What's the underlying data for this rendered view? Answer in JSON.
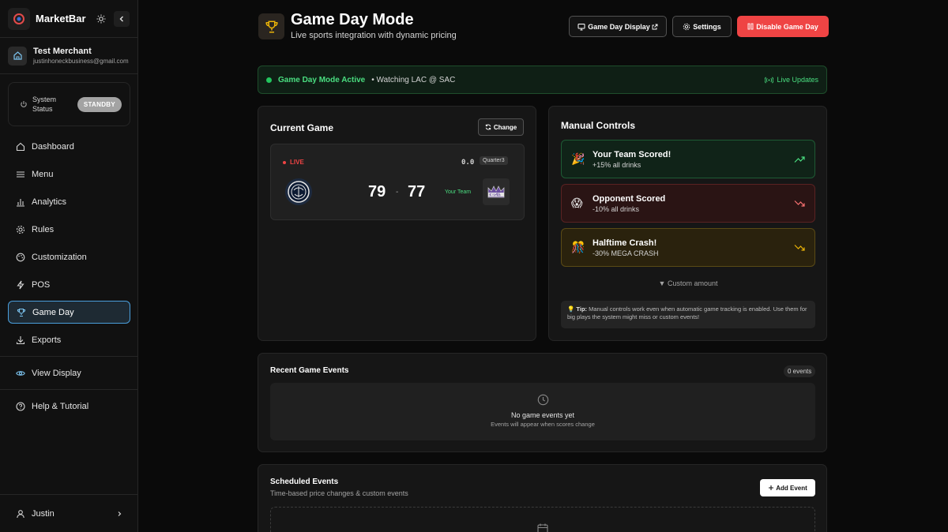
{
  "sidebar": {
    "brand": "MarketBar",
    "merchant": {
      "name": "Test Merchant",
      "email": "justinhoneckbusiness@gmail.com"
    },
    "status": {
      "label": "System Status",
      "value": "STANDBY"
    },
    "items": [
      {
        "label": "Dashboard",
        "icon": "home-icon"
      },
      {
        "label": "Menu",
        "icon": "menu-icon"
      },
      {
        "label": "Analytics",
        "icon": "bar-chart-icon"
      },
      {
        "label": "Rules",
        "icon": "gear-icon"
      },
      {
        "label": "Customization",
        "icon": "palette-icon"
      },
      {
        "label": "POS",
        "icon": "bolt-icon"
      },
      {
        "label": "Game Day",
        "icon": "trophy-icon",
        "active": true
      },
      {
        "label": "Exports",
        "icon": "download-icon"
      }
    ],
    "view_display": "View Display",
    "help": "Help & Tutorial",
    "user": "Justin"
  },
  "header": {
    "title": "Game Day Mode",
    "subtitle": "Live sports integration with dynamic pricing",
    "display_btn": "Game Day Display",
    "settings_btn": "Settings",
    "disable_btn": "Disable Game Day"
  },
  "banner": {
    "status": "Game Day Mode Active",
    "watching": "• Watching LAC @ SAC",
    "live_updates": "Live Updates"
  },
  "current_game": {
    "title": "Current Game",
    "change_btn": "Change",
    "live_label": "LIVE",
    "clock": "0.0",
    "quarter": "Quarter3",
    "away_score": "79",
    "separator": "-",
    "home_score": "77",
    "your_team_label": "Your Team"
  },
  "manual_controls": {
    "title": "Manual Controls",
    "buttons": [
      {
        "emoji": "🎉",
        "title": "Your Team Scored!",
        "subtitle": "+15% all drinks"
      },
      {
        "emoji": "😱",
        "title": "Opponent Scored",
        "subtitle": "-10% all drinks"
      },
      {
        "emoji": "🎊",
        "title": "Halftime Crash!",
        "subtitle": "-30% MEGA CRASH"
      }
    ],
    "custom_amount": "▼ Custom amount",
    "tip_label": "💡 Tip:",
    "tip_text": "Manual controls work even when automatic game tracking is enabled. Use them for big plays the system might miss or custom events!"
  },
  "recent_events": {
    "title": "Recent Game Events",
    "count": "0 events",
    "empty_title": "No game events yet",
    "empty_sub": "Events will appear when scores change"
  },
  "scheduled": {
    "title": "Scheduled Events",
    "subtitle": "Time-based price changes & custom events",
    "add_btn": "Add Event"
  },
  "colors": {
    "accent_red": "#ef4444",
    "accent_green": "#22c55e",
    "active_blue": "#4a9edb"
  }
}
